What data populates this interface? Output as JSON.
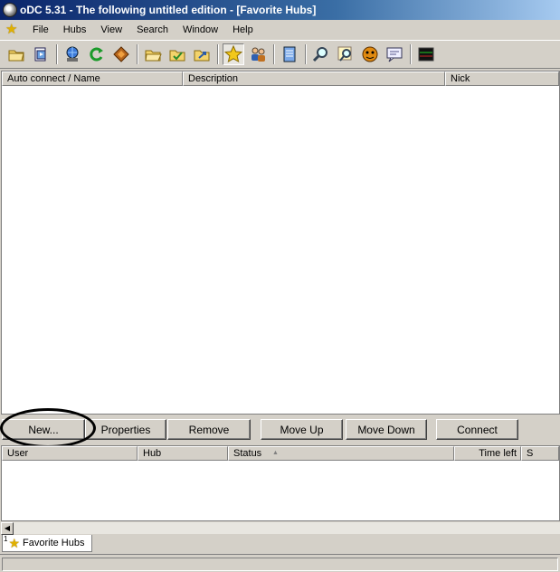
{
  "window": {
    "title": "oDC 5.31 - The following untitled edition - [Favorite Hubs]"
  },
  "menu": [
    "File",
    "Hubs",
    "View",
    "Search",
    "Window",
    "Help"
  ],
  "toolbar_icons": [
    "open-folder-icon",
    "open-file-list-icon",
    "network-icon",
    "refresh-icon",
    "reconnect-icon",
    "folder-open-icon",
    "folder-check-icon",
    "folder-arrow-icon",
    "favorite-hubs-icon",
    "favorite-users-icon",
    "notepad-icon",
    "search-icon",
    "search-spy-icon",
    "ad-search-icon",
    "chat-icon",
    "network-stats-icon"
  ],
  "hubs_table": {
    "columns": [
      "Auto connect / Name",
      "Description",
      "Nick"
    ]
  },
  "buttons": {
    "new": "New...",
    "properties": "Properties",
    "remove": "Remove",
    "move_up": "Move Up",
    "move_down": "Move Down",
    "connect": "Connect"
  },
  "transfer_table": {
    "columns": [
      "User",
      "Hub",
      "Status",
      "Time left",
      "S"
    ],
    "sort_indicator": "▲"
  },
  "tabs": [
    {
      "number": "1",
      "label": "Favorite Hubs"
    }
  ],
  "colors": {
    "title_start": "#0a246a",
    "title_end": "#a6caf0",
    "face": "#d4d0c8",
    "star": "#e0b000"
  }
}
